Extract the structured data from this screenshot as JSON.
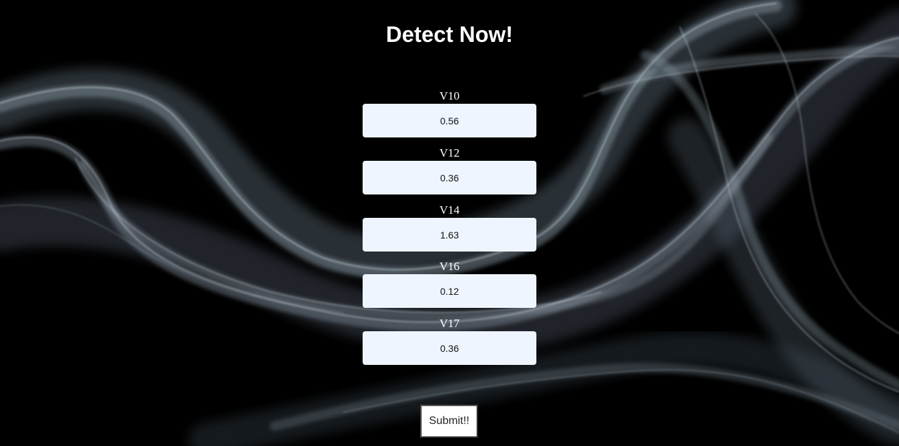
{
  "header": {
    "title": "Detect Now!"
  },
  "form": {
    "fields": [
      {
        "label": "V10",
        "value": "0.56"
      },
      {
        "label": "V12",
        "value": "0.36"
      },
      {
        "label": "V14",
        "value": "1.63"
      },
      {
        "label": "V16",
        "value": "0.12"
      },
      {
        "label": "V17",
        "value": "0.36"
      }
    ],
    "submit_label": "Submit!!"
  },
  "theme": {
    "background": "#000000",
    "input_background": "#eef5fe",
    "text_color": "#ffffff"
  }
}
